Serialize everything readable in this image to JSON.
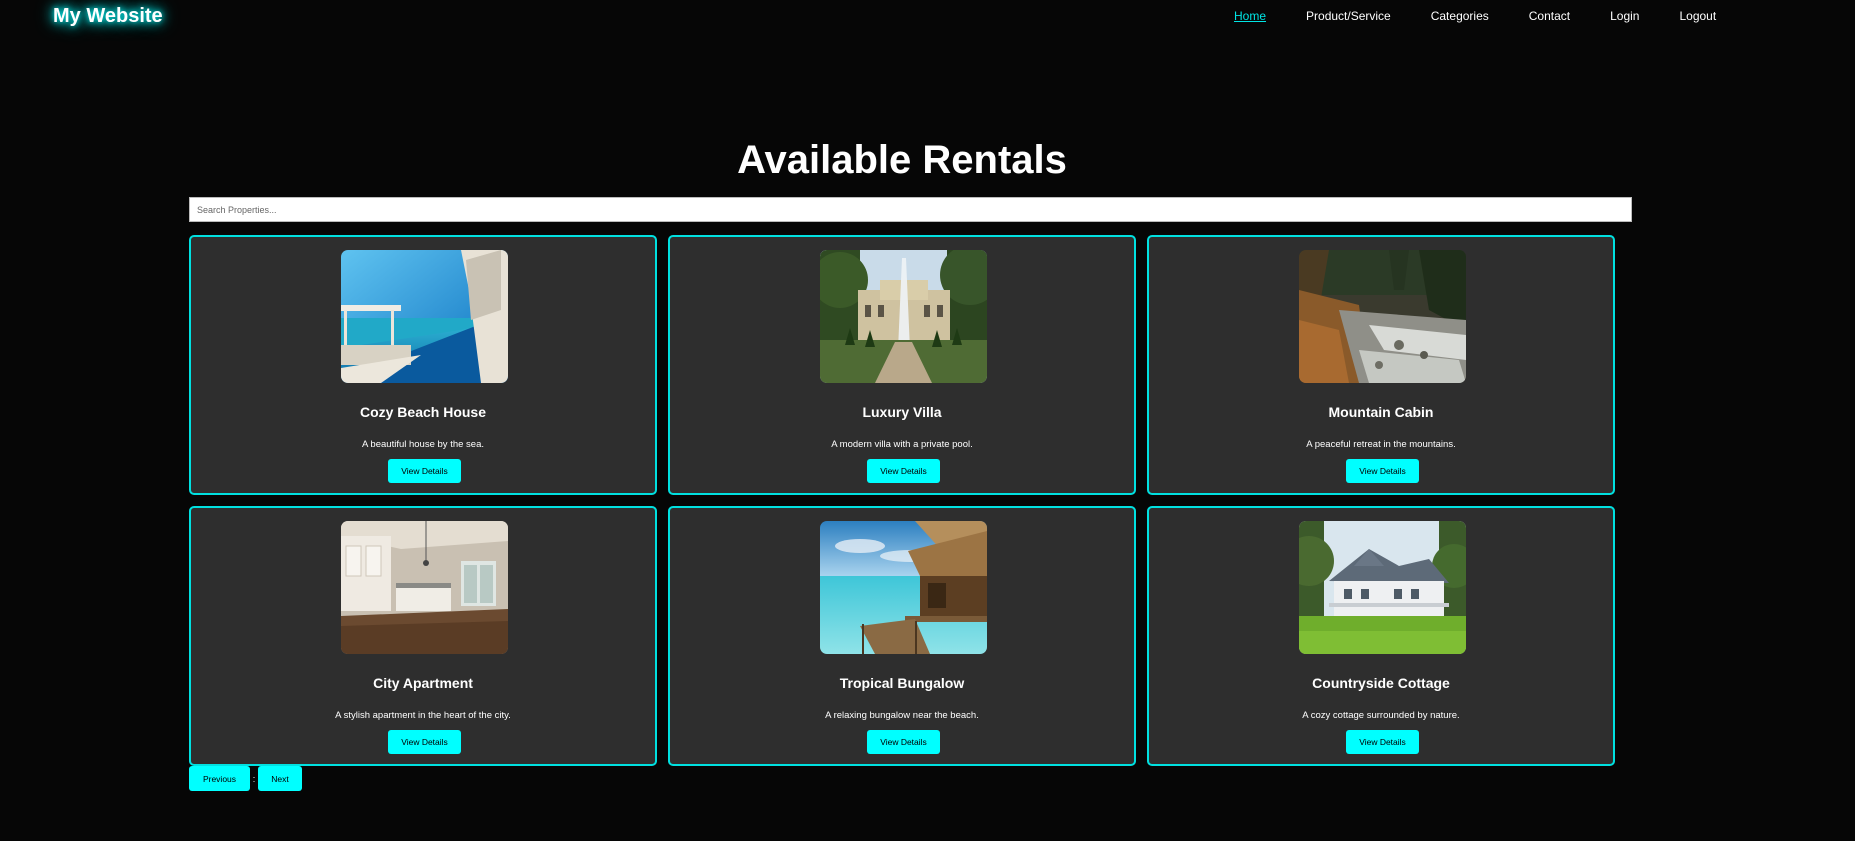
{
  "header": {
    "logo": "My Website",
    "nav": [
      {
        "label": "Home",
        "active": true
      },
      {
        "label": "Product/Service",
        "active": false
      },
      {
        "label": "Categories",
        "active": false
      },
      {
        "label": "Contact",
        "active": false
      },
      {
        "label": "Login",
        "active": false
      },
      {
        "label": "Logout",
        "active": false
      }
    ]
  },
  "main": {
    "title": "Available Rentals",
    "search_placeholder": "Search Properties...",
    "cards": [
      {
        "name": "Cozy Beach House",
        "description": "A beautiful house by the sea.",
        "button": "View Details",
        "image": "beach-house-photo"
      },
      {
        "name": "Luxury Villa",
        "description": "A modern villa with a private pool.",
        "button": "View Details",
        "image": "villa-fountain-photo"
      },
      {
        "name": "Mountain Cabin",
        "description": "A peaceful retreat in the mountains.",
        "button": "View Details",
        "image": "mountain-stream-photo"
      },
      {
        "name": "City Apartment",
        "description": "A stylish apartment in the heart of the city.",
        "button": "View Details",
        "image": "apartment-kitchen-photo"
      },
      {
        "name": "Tropical Bungalow",
        "description": "A relaxing bungalow near the beach.",
        "button": "View Details",
        "image": "overwater-bungalow-photo"
      },
      {
        "name": "Countryside Cottage",
        "description": "A cozy cottage surrounded by nature.",
        "button": "View Details",
        "image": "countryside-house-photo"
      }
    ],
    "pagination": {
      "previous": "Previous",
      "separator": ":",
      "next": "Next"
    }
  },
  "colors": {
    "accent": "#00ffff",
    "card_border": "#00e0e0",
    "card_bg": "#2e2e2e",
    "page_bg": "#060606"
  }
}
